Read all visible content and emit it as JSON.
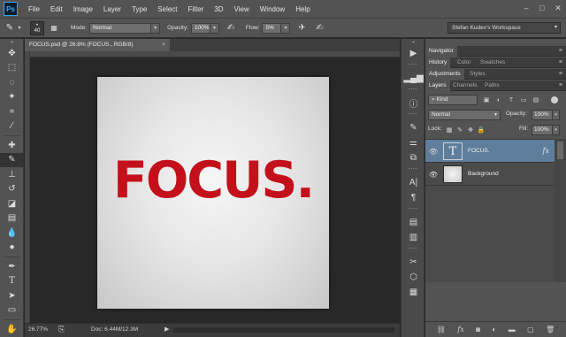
{
  "app": {
    "logo": "Ps"
  },
  "menubar": {
    "items": [
      "File",
      "Edit",
      "Image",
      "Layer",
      "Type",
      "Select",
      "Filter",
      "3D",
      "View",
      "Window",
      "Help"
    ]
  },
  "options": {
    "brush_size": "40",
    "mode_label": "Mode:",
    "mode_value": "Normal",
    "opacity_label": "Opacity:",
    "opacity_value": "100%",
    "flow_label": "Flow:",
    "flow_value": "5%",
    "workspace": "Stefan Kudev's Workspace"
  },
  "document": {
    "tab_title": "FOCUS.psd @ 26.8% (FOCUS., RGB/8)",
    "canvas_text": "FOCUS.",
    "text_color": "#c4101a"
  },
  "status": {
    "zoom": "26.77%",
    "doc_size": "Doc: 6.44M/12.3M"
  },
  "panels": {
    "group1": [
      "Navigator"
    ],
    "group2": [
      "History",
      "Color",
      "Swatches"
    ],
    "group3": [
      "Adjustments",
      "Styles"
    ],
    "group4": [
      "Layers",
      "Channels",
      "Paths"
    ]
  },
  "layers": {
    "filter_kind": "Kind",
    "blend_mode": "Normal",
    "opacity_label": "Opacity:",
    "opacity_value": "100%",
    "lock_label": "Lock:",
    "fill_label": "Fill:",
    "fill_value": "100%",
    "items": [
      {
        "name": "FOCUS.",
        "type_glyph": "T",
        "fx": "fx",
        "selected": true
      },
      {
        "name": "Background",
        "selected": false
      }
    ]
  },
  "colors": {
    "accent_selected": "#5e7e9b",
    "focus_red": "#c4101a"
  }
}
